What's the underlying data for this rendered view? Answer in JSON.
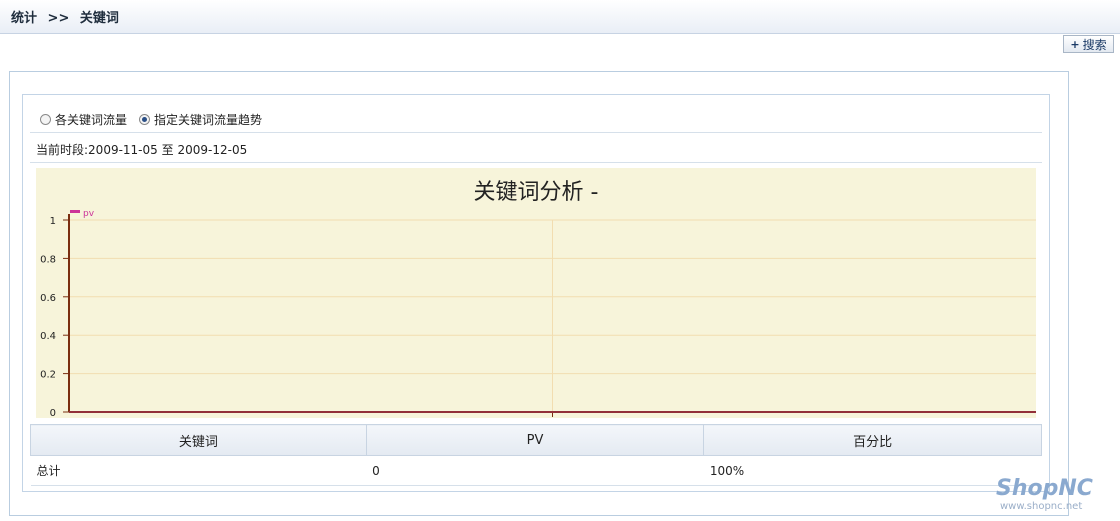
{
  "header": {
    "crumb_root": "统计",
    "crumb_sep": ">>",
    "crumb_current": "关键词"
  },
  "toolbar": {
    "search_label": "搜索"
  },
  "view_options": {
    "option1": "各关键词流量",
    "option2": "指定关键词流量趋势",
    "selected": "option2"
  },
  "period": {
    "label": "当前时段:",
    "start": "2009-11-05",
    "to": "至",
    "end": "2009-12-05"
  },
  "chart_data": {
    "type": "line",
    "title": "关键词分析 -",
    "series": [
      {
        "name": "pv",
        "values": [
          0,
          0
        ]
      }
    ],
    "x": [
      "",
      ""
    ],
    "ylim": [
      0,
      1
    ],
    "yticks": [
      "0",
      "0.2",
      "0.4",
      "0.6",
      "0.8",
      "1"
    ],
    "grid": true,
    "legend": "top-left",
    "colors": {
      "background": "#f7f4da",
      "axis": "#7a2e10",
      "series": "#cc3399",
      "grid": "#f2ddb0"
    }
  },
  "table": {
    "headers": [
      "关键词",
      "PV",
      "百分比"
    ],
    "rows": [
      [
        "总计",
        "0",
        "100%"
      ]
    ]
  },
  "brand": {
    "logo_text": "ShopNC",
    "url": "www.shopnc.net"
  }
}
